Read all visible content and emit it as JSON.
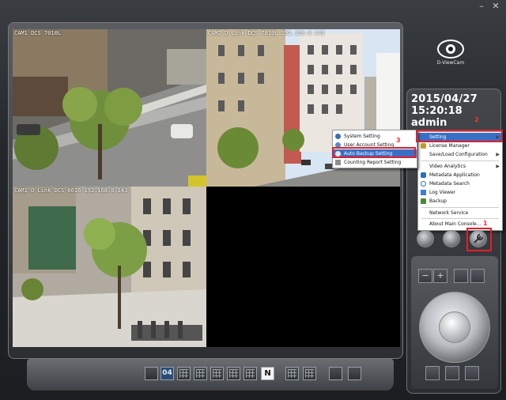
{
  "window": {
    "minimize_glyph": "–",
    "close_glyph": "✕"
  },
  "cameras": [
    {
      "label": "CAM1 DCS 7010L",
      "sub": ""
    },
    {
      "label": "CAM2 D Link DCS 7010L 192.168.0.143",
      "sub": ""
    },
    {
      "label": "CAM1 D Link DCS 6616 192.168.0.143",
      "sub": ""
    }
  ],
  "logo": {
    "text": "D-ViewCam",
    "icon": "eye-logo-icon"
  },
  "info": {
    "date": "2015/04/27",
    "time": "15:20:18",
    "user": "admin"
  },
  "menu": {
    "items": [
      {
        "label": "Setting",
        "icon": "gear-icon",
        "has_submenu": true
      },
      {
        "label": "License Manager",
        "icon": "key-icon"
      },
      {
        "label": "Save/Load Configuration",
        "icon": "",
        "has_submenu": true
      },
      {
        "label": "Video Analytics",
        "icon": "",
        "has_submenu": true
      },
      {
        "label": "Metadata Application",
        "icon": "metadata-icon"
      },
      {
        "label": "Metadata Search",
        "icon": "search-icon"
      },
      {
        "label": "Log Viewer",
        "icon": "log-icon"
      },
      {
        "label": "Backup",
        "icon": "backup-icon"
      },
      {
        "label": "Network Service",
        "icon": ""
      },
      {
        "label": "About Main Console...",
        "icon": ""
      }
    ]
  },
  "submenu": {
    "items": [
      {
        "label": "System Setting",
        "icon": "system-icon"
      },
      {
        "label": "User Account Setting",
        "icon": "user-icon"
      },
      {
        "label": "Auto Backup Setting",
        "icon": "backup-icon"
      },
      {
        "label": "Counting Report Setting",
        "icon": "report-icon"
      }
    ]
  },
  "annotations": {
    "n1": "1",
    "n2": "2",
    "n3": "3"
  },
  "layout_bar": {
    "active_label": "04",
    "n_label": "N"
  },
  "colors": {
    "highlight": "#3b6fc6",
    "annotation_red": "#e0202a"
  }
}
